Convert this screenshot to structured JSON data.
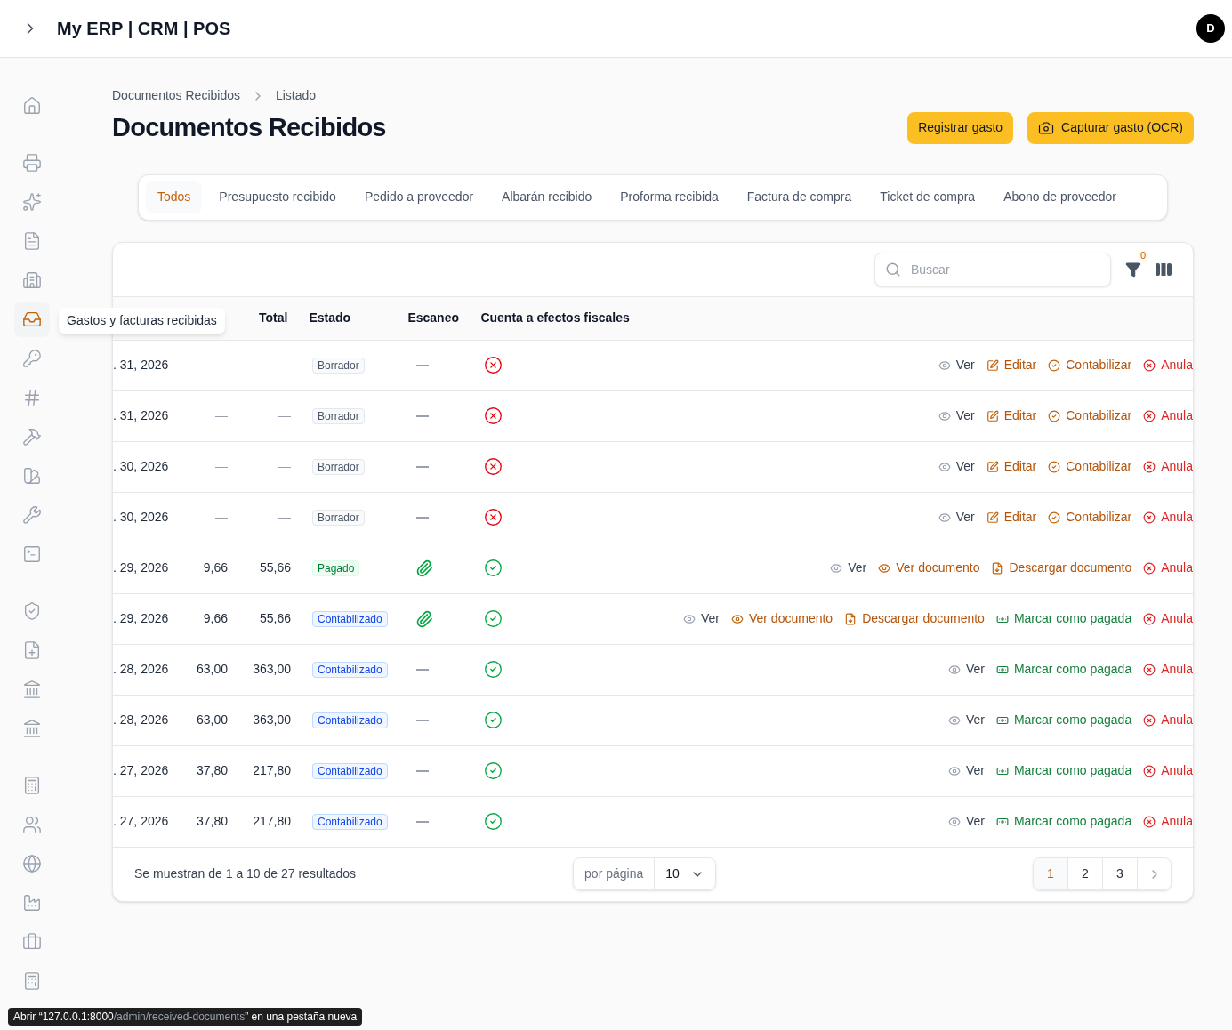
{
  "header": {
    "title": "My ERP | CRM | POS",
    "avatar": "D"
  },
  "sidebar": {
    "groups": [
      {
        "items": [
          {
            "selected": false
          }
        ]
      },
      {
        "items": [
          {
            "selected": false
          },
          {
            "selected": false
          },
          {
            "selected": false
          },
          {
            "selected": false
          },
          {
            "selected": true
          },
          {
            "selected": false
          },
          {
            "selected": false
          },
          {
            "selected": false
          },
          {
            "selected": false
          },
          {
            "selected": false
          },
          {
            "selected": false
          }
        ]
      },
      {
        "items": [
          {
            "selected": false
          },
          {
            "selected": false
          },
          {
            "selected": false
          },
          {
            "selected": false
          }
        ]
      },
      {
        "items": [
          {
            "selected": false
          },
          {
            "selected": false
          },
          {
            "selected": false
          },
          {
            "selected": false
          },
          {
            "selected": false
          },
          {
            "selected": false
          }
        ]
      }
    ]
  },
  "tooltip": "Gastos y facturas recibidas",
  "breadcrumb": [
    "Documentos Recibidos",
    "Listado"
  ],
  "page_title": "Documentos Recibidos",
  "buttons": [
    {
      "label": "Registrar gasto",
      "kind": "plain"
    },
    {
      "label": "Capturar gasto (OCR)",
      "kind": "camera"
    }
  ],
  "tabs": [
    {
      "label": "Todos",
      "selected": true
    },
    {
      "label": "Presupuesto recibido",
      "selected": false
    },
    {
      "label": "Pedido a proveedor",
      "selected": false
    },
    {
      "label": "Albarán recibido",
      "selected": false
    },
    {
      "label": "Proforma recibida",
      "selected": false
    },
    {
      "label": "Factura de compra",
      "selected": false
    },
    {
      "label": "Ticket de compra",
      "selected": false
    },
    {
      "label": "Abono de proveedor",
      "selected": false
    }
  ],
  "search": {
    "placeholder": "Buscar"
  },
  "filter_count": "0",
  "table": {
    "columns": [
      "Total",
      "Estado",
      "Escaneo",
      "Cuenta a efectos fiscales"
    ],
    "rows": [
      {
        "column_1": ". 31, 2026",
        "column_2": "—",
        "total": "—",
        "status": {
          "label": "Borrador",
          "kind": "draft"
        },
        "scan_attached": false,
        "fiscal": false,
        "actions": [
          {
            "label": "Ver",
            "kind": "view"
          },
          {
            "label": "Editar",
            "kind": "edit"
          },
          {
            "label": "Contabilizar",
            "kind": "post"
          },
          {
            "label": "Anula",
            "kind": "cancel"
          }
        ]
      },
      {
        "column_1": ". 31, 2026",
        "column_2": "—",
        "total": "—",
        "status": {
          "label": "Borrador",
          "kind": "draft"
        },
        "scan_attached": false,
        "fiscal": false,
        "actions": [
          {
            "label": "Ver",
            "kind": "view"
          },
          {
            "label": "Editar",
            "kind": "edit"
          },
          {
            "label": "Contabilizar",
            "kind": "post"
          },
          {
            "label": "Anula",
            "kind": "cancel"
          }
        ]
      },
      {
        "column_1": ". 30, 2026",
        "column_2": "—",
        "total": "—",
        "status": {
          "label": "Borrador",
          "kind": "draft"
        },
        "scan_attached": false,
        "fiscal": false,
        "actions": [
          {
            "label": "Ver",
            "kind": "view"
          },
          {
            "label": "Editar",
            "kind": "edit"
          },
          {
            "label": "Contabilizar",
            "kind": "post"
          },
          {
            "label": "Anula",
            "kind": "cancel"
          }
        ]
      },
      {
        "column_1": ". 30, 2026",
        "column_2": "—",
        "total": "—",
        "status": {
          "label": "Borrador",
          "kind": "draft"
        },
        "scan_attached": false,
        "fiscal": false,
        "actions": [
          {
            "label": "Ver",
            "kind": "view"
          },
          {
            "label": "Editar",
            "kind": "edit"
          },
          {
            "label": "Contabilizar",
            "kind": "post"
          },
          {
            "label": "Anula",
            "kind": "cancel"
          }
        ]
      },
      {
        "column_1": ". 29, 2026",
        "column_2": "9,66",
        "total": "55,66",
        "status": {
          "label": "Pagado",
          "kind": "paid"
        },
        "scan_attached": true,
        "fiscal": true,
        "actions": [
          {
            "label": "Ver",
            "kind": "view"
          },
          {
            "label": "Ver documento",
            "kind": "view_doc"
          },
          {
            "label": "Descargar documento",
            "kind": "download"
          },
          {
            "label": "Anula",
            "kind": "cancel"
          }
        ]
      },
      {
        "column_1": ". 29, 2026",
        "column_2": "9,66",
        "total": "55,66",
        "status": {
          "label": "Contabilizado",
          "kind": "posted"
        },
        "scan_attached": true,
        "fiscal": true,
        "actions": [
          {
            "label": "Ver",
            "kind": "view"
          },
          {
            "label": "Ver documento",
            "kind": "view_doc"
          },
          {
            "label": "Descargar documento",
            "kind": "download"
          },
          {
            "label": "Marcar como pagada",
            "kind": "mark_paid"
          },
          {
            "label": "Anula",
            "kind": "cancel"
          }
        ]
      },
      {
        "column_1": ". 28, 2026",
        "column_2": "63,00",
        "total": "363,00",
        "status": {
          "label": "Contabilizado",
          "kind": "posted"
        },
        "scan_attached": false,
        "fiscal": true,
        "actions": [
          {
            "label": "Ver",
            "kind": "view"
          },
          {
            "label": "Marcar como pagada",
            "kind": "mark_paid"
          },
          {
            "label": "Anula",
            "kind": "cancel"
          }
        ]
      },
      {
        "column_1": ". 28, 2026",
        "column_2": "63,00",
        "total": "363,00",
        "status": {
          "label": "Contabilizado",
          "kind": "posted"
        },
        "scan_attached": false,
        "fiscal": true,
        "actions": [
          {
            "label": "Ver",
            "kind": "view"
          },
          {
            "label": "Marcar como pagada",
            "kind": "mark_paid"
          },
          {
            "label": "Anula",
            "kind": "cancel"
          }
        ]
      },
      {
        "column_1": ". 27, 2026",
        "column_2": "37,80",
        "total": "217,80",
        "status": {
          "label": "Contabilizado",
          "kind": "posted"
        },
        "scan_attached": false,
        "fiscal": true,
        "actions": [
          {
            "label": "Ver",
            "kind": "view"
          },
          {
            "label": "Marcar como pagada",
            "kind": "mark_paid"
          },
          {
            "label": "Anula",
            "kind": "cancel"
          }
        ]
      },
      {
        "column_1": ". 27, 2026",
        "column_2": "37,80",
        "total": "217,80",
        "status": {
          "label": "Contabilizado",
          "kind": "posted"
        },
        "scan_attached": false,
        "fiscal": true,
        "actions": [
          {
            "label": "Ver",
            "kind": "view"
          },
          {
            "label": "Marcar como pagada",
            "kind": "mark_paid"
          },
          {
            "label": "Anula",
            "kind": "cancel"
          }
        ]
      }
    ]
  },
  "footer": {
    "summary": "Se muestran de 1 a 10 de 27 resultados",
    "per_page_label": "por página",
    "per_page_value": "10",
    "pages": [
      {
        "label": "1",
        "selected": true
      },
      {
        "label": "2",
        "selected": false
      },
      {
        "label": "3",
        "selected": false
      }
    ]
  },
  "status_bar": [
    {
      "text": "Abrir “127.0.0.1:8000",
      "kind": "strong"
    },
    {
      "text": "/admin/received-documents",
      "kind": "dim"
    },
    {
      "text": "” en una pestaña nueva",
      "kind": "strong"
    }
  ]
}
